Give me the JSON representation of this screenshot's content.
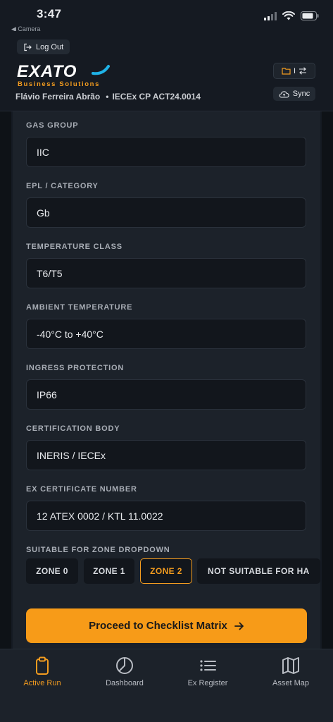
{
  "status_bar": {
    "time": "3:47",
    "back_label": "◀ Camera"
  },
  "header": {
    "logout_label": "Log Out",
    "logo_text": "EXATO",
    "logo_tagline": "Business Solutions",
    "user_name": "Flávio Ferreira Abrão",
    "separator": "•",
    "certification": "IECEx CP ACT24.0014",
    "mode_label": "I",
    "sync_label": "Sync"
  },
  "fields": [
    {
      "label": "GAS GROUP",
      "value": "IIC"
    },
    {
      "label": "EPL / CATEGORY",
      "value": "Gb"
    },
    {
      "label": "TEMPERATURE CLASS",
      "value": "T6/T5"
    },
    {
      "label": "AMBIENT TEMPERATURE",
      "value": "-40°C to +40°C"
    },
    {
      "label": "INGRESS PROTECTION",
      "value": "IP66"
    },
    {
      "label": "CERTIFICATION BODY",
      "value": "INERIS / IECEx"
    },
    {
      "label": "EX CERTIFICATE NUMBER",
      "value": "12 ATEX 0002 / KTL 11.0022"
    }
  ],
  "zone": {
    "label": "SUITABLE FOR ZONE DROPDOWN",
    "options": [
      "ZONE 0",
      "ZONE 1",
      "ZONE 2",
      "NOT SUITABLE FOR HA"
    ],
    "selected": "ZONE 2"
  },
  "proceed_label": "Proceed to Checklist Matrix",
  "tabs": [
    {
      "label": "Active Run",
      "icon": "clipboard-icon",
      "active": true
    },
    {
      "label": "Dashboard",
      "icon": "pie-chart-icon",
      "active": false
    },
    {
      "label": "Ex Register",
      "icon": "list-icon",
      "active": false
    },
    {
      "label": "Asset Map",
      "icon": "map-icon",
      "active": false
    }
  ],
  "colors": {
    "accent": "#f39c1f",
    "button": "#f79b18",
    "background": "#151a22",
    "card": "#1c222a",
    "input": "#12161c"
  }
}
